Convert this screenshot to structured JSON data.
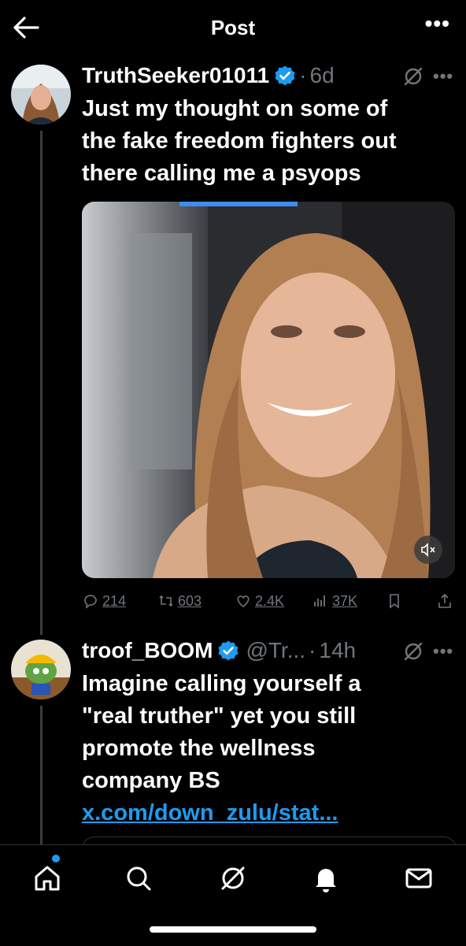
{
  "header": {
    "title": "Post"
  },
  "post": {
    "display_name": "TruthSeeker01011",
    "time": "6d",
    "text_lines": [
      "Just my thought on some of",
      "the fake freedom fighters out",
      "there calling me a psyops"
    ],
    "actions": {
      "replies": "214",
      "reposts": "603",
      "likes": "2.4K",
      "views": "37K"
    }
  },
  "reply": {
    "display_name": "troof_BOOM",
    "handle": "@Tr...",
    "time": "14h",
    "text_lines": [
      "Imagine calling yourself a",
      "\"real truther\" yet you still",
      "promote the wellness",
      "company BS"
    ],
    "link": "x.com/down_zulu/stat..."
  },
  "tabbar": {
    "items": [
      "home-icon",
      "search-icon",
      "grok-icon",
      "notifications-icon",
      "messages-icon"
    ]
  },
  "colors": {
    "accent": "#1d9bf0",
    "muted": "#71767b",
    "background": "#000000"
  }
}
